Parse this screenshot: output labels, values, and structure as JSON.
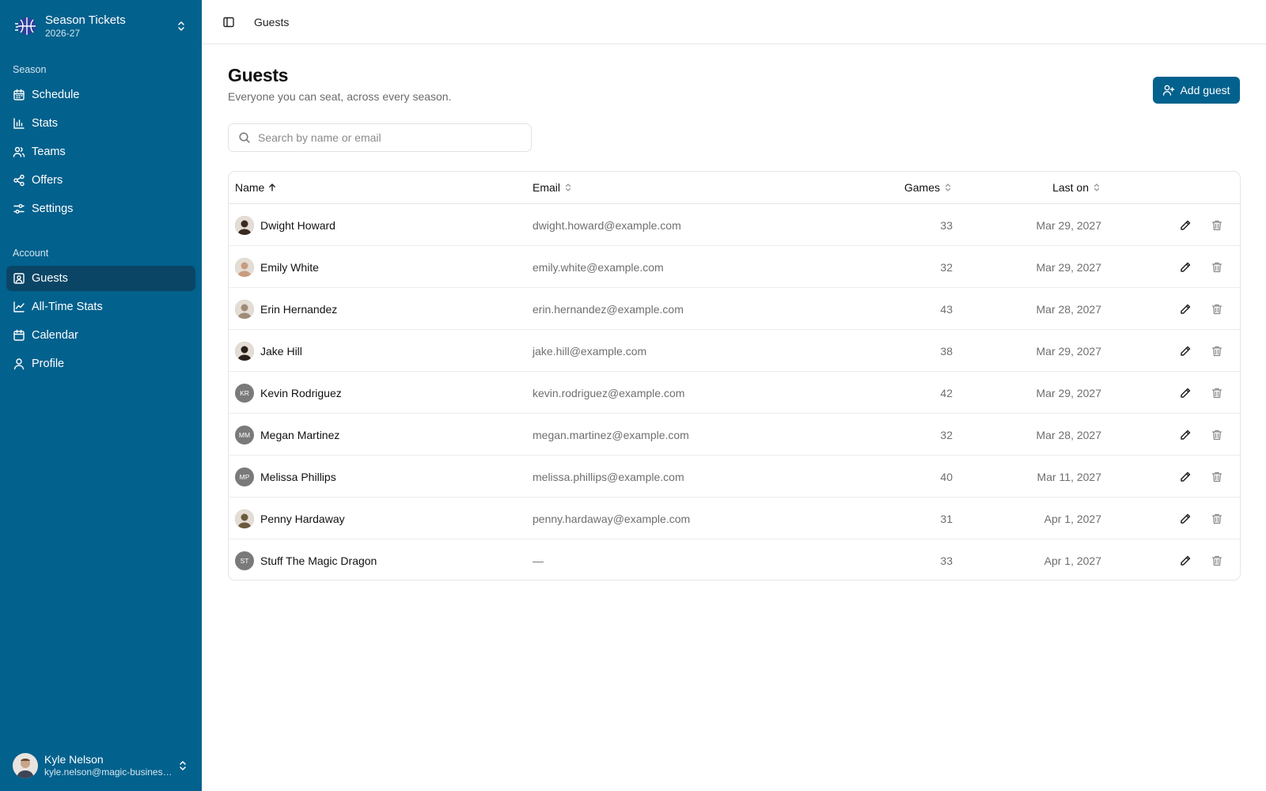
{
  "org": {
    "name": "Season Tickets",
    "season": "2026-27"
  },
  "sidebar": {
    "season_label": "Season",
    "season_items": [
      {
        "label": "Schedule",
        "icon": "calendar-icon"
      },
      {
        "label": "Stats",
        "icon": "bar-chart-icon"
      },
      {
        "label": "Teams",
        "icon": "users-icon"
      },
      {
        "label": "Offers",
        "icon": "share-icon"
      },
      {
        "label": "Settings",
        "icon": "sliders-icon"
      }
    ],
    "account_label": "Account",
    "account_items": [
      {
        "label": "Guests",
        "icon": "contact-icon",
        "active": true
      },
      {
        "label": "All-Time Stats",
        "icon": "line-chart-icon"
      },
      {
        "label": "Calendar",
        "icon": "calendar-icon"
      },
      {
        "label": "Profile",
        "icon": "user-icon"
      }
    ]
  },
  "user": {
    "name": "Kyle Nelson",
    "email": "kyle.nelson@magic-business.com"
  },
  "topbar": {
    "breadcrumb": "Guests"
  },
  "page": {
    "title": "Guests",
    "subtitle": "Everyone you can seat, across every season.",
    "add_button": "Add guest"
  },
  "search": {
    "placeholder": "Search by name or email",
    "value": ""
  },
  "table": {
    "columns": {
      "name": "Name",
      "email": "Email",
      "games": "Games",
      "last_on": "Last on"
    },
    "rows": [
      {
        "name": "Dwight Howard",
        "email": "dwight.howard@example.com",
        "games": "33",
        "last_on": "Mar 29, 2027",
        "initials": "",
        "photo": "#3a2a22"
      },
      {
        "name": "Emily White",
        "email": "emily.white@example.com",
        "games": "32",
        "last_on": "Mar 29, 2027",
        "initials": "",
        "photo": "#c89c7f"
      },
      {
        "name": "Erin Hernandez",
        "email": "erin.hernandez@example.com",
        "games": "43",
        "last_on": "Mar 28, 2027",
        "initials": "",
        "photo": "#9e8b78"
      },
      {
        "name": "Jake Hill",
        "email": "jake.hill@example.com",
        "games": "38",
        "last_on": "Mar 29, 2027",
        "initials": "",
        "photo": "#2a1f1a"
      },
      {
        "name": "Kevin Rodriguez",
        "email": "kevin.rodriguez@example.com",
        "games": "42",
        "last_on": "Mar 29, 2027",
        "initials": "KR",
        "photo": ""
      },
      {
        "name": "Megan Martinez",
        "email": "megan.martinez@example.com",
        "games": "32",
        "last_on": "Mar 28, 2027",
        "initials": "MM",
        "photo": ""
      },
      {
        "name": "Melissa Phillips",
        "email": "melissa.phillips@example.com",
        "games": "40",
        "last_on": "Mar 11, 2027",
        "initials": "MP",
        "photo": ""
      },
      {
        "name": "Penny Hardaway",
        "email": "penny.hardaway@example.com",
        "games": "31",
        "last_on": "Apr 1, 2027",
        "initials": "",
        "photo": "#6b5a3e"
      },
      {
        "name": "Stuff The Magic Dragon",
        "email": "—",
        "games": "33",
        "last_on": "Apr 1, 2027",
        "initials": "ST",
        "photo": ""
      }
    ]
  },
  "colors": {
    "sidebar": "#02618d",
    "sidebar_active": "#0a4565",
    "accent": "#02618d"
  }
}
